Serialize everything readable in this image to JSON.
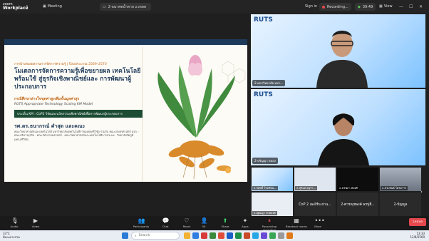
{
  "app": {
    "logo_line1": "zoom",
    "logo_line2": "Workplace"
  },
  "topbar": {
    "home_label": "⌂",
    "meeting_label": "Meeting",
    "share_label": "2-อนาคตน้ำตาล แวดดด",
    "sign_in": "Sign in",
    "recording": "Recording...",
    "timer": "39:49",
    "view": "View"
  },
  "slide": {
    "year": "การนำเสนอผลงานการจัดการความรู้ | ปีงบประมาณ 2569–2570",
    "title": "โมเดลการจัดการความรู้เพื่อขยายผล เทคโนโลยีพร้อมใช้ สู่ธุรกิจเชิงพาณิชย์และ การพัฒนาผู้ประกอบการ",
    "subtitle": "กรณีศึกษาล่างใจขุดค่าสูงเพิ่มขั้นมูลค่าสูง",
    "subtitle_en": "RUTS Appropriate Technology Scaling KM Model",
    "badge": "ประเด็น KM : CoP2 วิจัยและนวัตกรรมเชิงพาณิชย์เพื่อการพัฒนาผู้ประกอบการ",
    "author": "รศ.ดร.ธนากรณ์ คำสุด และคณะ",
    "affiliation": "คณะวิทยาศาสตร์และเทคโนโลยี มหาวิทยาลัยเทคโนโลยีราชมงคลศรีวิชัย ร่วมกับ คณะเกษตรศาสตร์ มรภ. · คณะบริหารธุรกิจ · คณะวิศวกรรมศาสตร์ · คณะวิทยาศาสตร์และเทคโนโลยีการประมง · วิทยาลัยรัตภูมิ มทร.ศรีวิชัย"
  },
  "tiles": [
    {
      "label": "2-มหาวิทยาลัย มหา..."
    },
    {
      "label": "2-ปริญญา ลดลง"
    }
  ],
  "thumbs": [
    {
      "label": "2-วิสุทธิ์ โรงเรียน..."
    },
    {
      "label": "2-สุวิมล อนุรา..."
    },
    {
      "label": "2-พรนิภา ทองดี"
    },
    {
      "label": "2-ประพันธ์ โครงการ"
    },
    {
      "label": "3-ญัณญา บัวทองดี"
    }
  ],
  "name_tiles": [
    {
      "label": "CoP 2 เพเลิร์น ผ่าน..."
    },
    {
      "label": "2-ศวรณุชพงค์ พรนุ่ยี่..."
    },
    {
      "label": "2-ปัญญูล"
    }
  ],
  "toolbar": {
    "audio": "Audio",
    "video": "Video",
    "participants": "Participants",
    "participants_count": "50",
    "chat": "Chat",
    "react": "React",
    "share": "Share",
    "apps": "Apps",
    "more": "More",
    "record_label": "Pause/stop recording",
    "breakout": "Breakout rooms",
    "leave": "Leave"
  },
  "taskbar": {
    "weather_temp": "33°C",
    "weather_desc": "มีเมฆบางส่วน",
    "search": "Search",
    "time": "13:33",
    "date": "12/8/2569"
  },
  "colors": {
    "accent": "#1e3a5a",
    "orange": "#c46a1b",
    "green": "#1c4d34",
    "rec": "#e5484d"
  }
}
